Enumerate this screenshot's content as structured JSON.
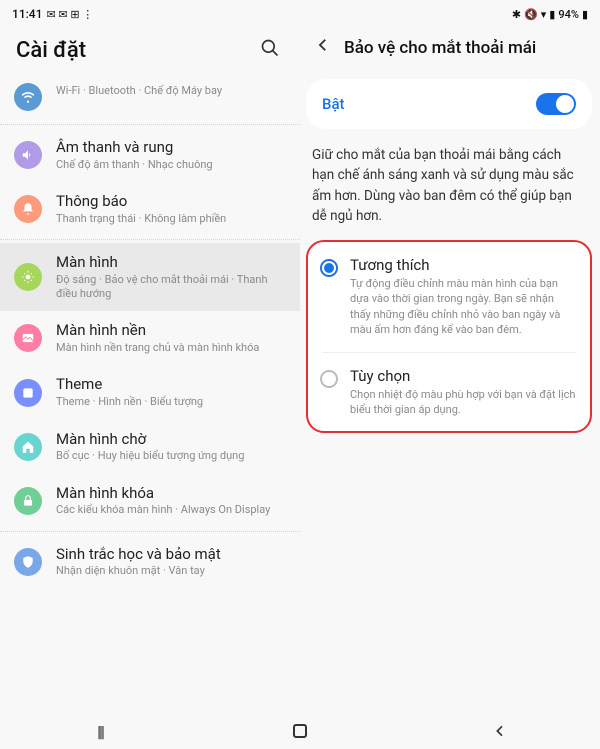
{
  "status_bar": {
    "time": "11:41",
    "battery_text": "94%"
  },
  "left": {
    "header": "Cài đặt",
    "items": {
      "connections": {
        "sub": "Wi-Fi · Bluetooth · Chế độ Máy bay"
      },
      "sound": {
        "title": "Âm thanh và rung",
        "sub": "Chế độ âm thanh · Nhạc chuông"
      },
      "notifications": {
        "title": "Thông báo",
        "sub": "Thanh trạng thái · Không làm phiền"
      },
      "display": {
        "title": "Màn hình",
        "sub": "Độ sáng · Bảo vệ cho mắt thoải mái · Thanh điều hướng"
      },
      "wallpaper": {
        "title": "Màn hình nền",
        "sub": "Màn hình nền trang chủ và màn hình khóa"
      },
      "theme": {
        "title": "Theme",
        "sub": "Theme · Hình nền · Biểu tượng"
      },
      "homescreen": {
        "title": "Màn hình chờ",
        "sub": "Bố cục · Huy hiệu biểu tượng ứng dụng"
      },
      "lockscreen": {
        "title": "Màn hình khóa",
        "sub": "Các kiểu khóa màn hình · Always On Display"
      },
      "biometrics": {
        "title": "Sinh trắc học và bảo mật",
        "sub": "Nhận diện khuôn mặt · Vân tay"
      }
    }
  },
  "right": {
    "title": "Bảo vệ cho mắt thoải mái",
    "toggle_label": "Bật",
    "description": "Giữ cho mắt của bạn thoải mái bằng cách hạn chế ánh sáng xanh và sử dụng màu sắc ấm hơn. Dùng vào ban đêm có thể giúp bạn dễ ngủ hơn.",
    "opt_adaptive": {
      "title": "Tương thích",
      "sub": "Tự động điều chỉnh màu màn hình của bạn dựa vào thời gian trong ngày. Bạn sẽ nhận thấy những điều chỉnh nhỏ vào ban ngày và màu ấm hơn đáng kể vào ban đêm."
    },
    "opt_custom": {
      "title": "Tùy chọn",
      "sub": "Chọn nhiệt độ màu phù hợp với bạn và đặt lịch biểu thời gian áp dụng."
    }
  }
}
